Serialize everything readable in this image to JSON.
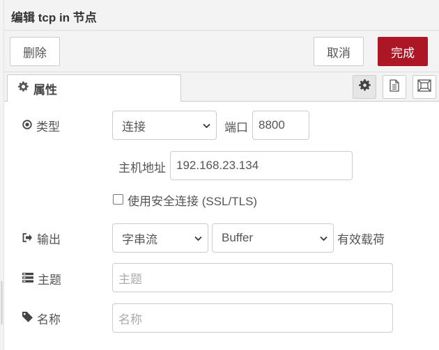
{
  "title": "编辑 tcp in 节点",
  "toolbar": {
    "delete_label": "删除",
    "cancel_label": "取消",
    "done_label": "完成"
  },
  "tabs": {
    "properties_label": "属性"
  },
  "form": {
    "type": {
      "label": "类型",
      "value": "连接",
      "port_label": "端口",
      "port_value": "8800"
    },
    "host": {
      "label": "主机地址",
      "value": "192.168.23.134"
    },
    "tls": {
      "label": "使用安全连接 (SSL/TLS)",
      "checked": false
    },
    "output": {
      "label": "输出",
      "mode_value": "字串流",
      "format_value": "Buffer",
      "suffix": "有效载荷"
    },
    "topic": {
      "label": "主题",
      "placeholder": "主题"
    },
    "name": {
      "label": "名称",
      "placeholder": "名称"
    }
  },
  "colors": {
    "accent": "#ad1625",
    "panel_bg": "#f3f3f3",
    "border": "#cccccc"
  }
}
